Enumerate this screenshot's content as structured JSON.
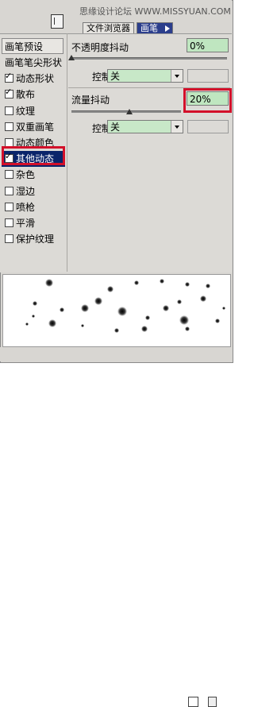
{
  "watermark": "思缘设计论坛 WWW.MISSYUAN.COM",
  "tabs": [
    {
      "label": "文件浏览器"
    },
    {
      "label": "画笔"
    }
  ],
  "sidebar": {
    "preset": "画笔预设",
    "items": [
      {
        "label": "画笔笔尖形状",
        "checkbox": false,
        "checked": false
      },
      {
        "label": "动态形状",
        "checkbox": true,
        "checked": true
      },
      {
        "label": "散布",
        "checkbox": true,
        "checked": true
      },
      {
        "label": "纹理",
        "checkbox": true,
        "checked": false
      },
      {
        "label": "双重画笔",
        "checkbox": true,
        "checked": false
      },
      {
        "label": "动态颜色",
        "checkbox": true,
        "checked": false
      },
      {
        "label": "其他动态",
        "checkbox": true,
        "checked": true
      },
      {
        "label": "杂色",
        "checkbox": true,
        "checked": false
      },
      {
        "label": "湿边",
        "checkbox": true,
        "checked": false
      },
      {
        "label": "喷枪",
        "checkbox": true,
        "checked": false
      },
      {
        "label": "平滑",
        "checkbox": true,
        "checked": false
      },
      {
        "label": "保护纹理",
        "checkbox": true,
        "checked": false
      }
    ]
  },
  "opacity": {
    "label": "不透明度抖动",
    "value": "0%",
    "control_label": "控制:",
    "control_value": "关",
    "slider": 0.0
  },
  "flow": {
    "label": "流量抖动",
    "value": "20%",
    "control_label": "控制:",
    "control_value": "关",
    "slider": 0.2
  },
  "colors": {
    "highlight": "#d3102a",
    "selected_bg": "#0a246a",
    "field_green": "#bfe6c0"
  }
}
